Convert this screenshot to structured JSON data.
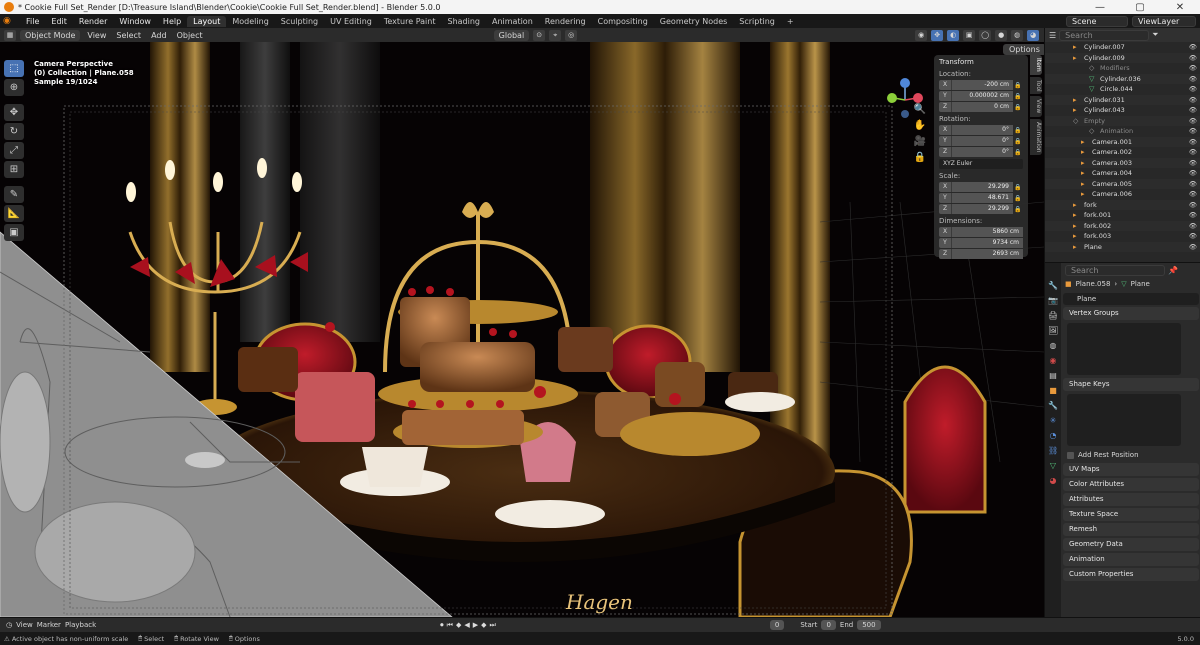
{
  "window": {
    "title": "* Cookie Full Set_Render [D:\\Treasure Island\\Blender\\Cookie\\Cookie Full Set_Render.blend] - Blender 5.0.0",
    "minimize": "—",
    "maximize": "▢",
    "close": "✕"
  },
  "menu": [
    "File",
    "Edit",
    "Render",
    "Window",
    "Help"
  ],
  "workspaces": [
    "Layout",
    "Modeling",
    "Sculpting",
    "UV Editing",
    "Texture Paint",
    "Shading",
    "Animation",
    "Rendering",
    "Compositing",
    "Geometry Nodes",
    "Scripting"
  ],
  "workspace_add": "+",
  "scene": "Scene",
  "view_layer": "ViewLayer",
  "viewport_header": {
    "mode": "Object Mode",
    "menus": [
      "View",
      "Select",
      "Add",
      "Object"
    ],
    "orientation": "Global",
    "options": "Options"
  },
  "overlay": {
    "line1": "Camera Perspective",
    "line2": "(0) Collection | Plane.058",
    "line3": "Sample 19/1024"
  },
  "signature": "Hagen",
  "npanel": {
    "header": "Transform",
    "location_label": "Location:",
    "location": [
      {
        "axis": "X",
        "value": "-200 cm"
      },
      {
        "axis": "Y",
        "value": "0.000002 cm"
      },
      {
        "axis": "Z",
        "value": "0 cm"
      }
    ],
    "rotation_label": "Rotation:",
    "rotation": [
      {
        "axis": "X",
        "value": "0°"
      },
      {
        "axis": "Y",
        "value": "0°"
      },
      {
        "axis": "Z",
        "value": "0°"
      }
    ],
    "rotation_mode": "XYZ Euler",
    "scale_label": "Scale:",
    "scale": [
      {
        "axis": "X",
        "value": "29.299"
      },
      {
        "axis": "Y",
        "value": "48.671"
      },
      {
        "axis": "Z",
        "value": "29.299"
      }
    ],
    "dimensions_label": "Dimensions:",
    "dimensions": [
      {
        "axis": "X",
        "value": "5860 cm"
      },
      {
        "axis": "Y",
        "value": "9734 cm"
      },
      {
        "axis": "Z",
        "value": "2693 cm"
      }
    ],
    "tabs": [
      "Item",
      "Tool",
      "View",
      "Animation"
    ]
  },
  "outliner": {
    "search_placeholder": "Search",
    "items": [
      {
        "name": "Cylinder.007",
        "kind": "o"
      },
      {
        "name": "Cylinder.009",
        "kind": "o"
      },
      {
        "name": "Modifiers",
        "kind": "c"
      },
      {
        "name": "Cylinder.036",
        "kind": "g"
      },
      {
        "name": "Circle.044",
        "kind": "g"
      },
      {
        "name": "Cylinder.031",
        "kind": "o"
      },
      {
        "name": "Cylinder.043",
        "kind": "o"
      },
      {
        "name": "Empty",
        "kind": "c"
      },
      {
        "name": "Animation",
        "kind": "c"
      },
      {
        "name": "Camera.001",
        "kind": "o"
      },
      {
        "name": "Camera.002",
        "kind": "o"
      },
      {
        "name": "Camera.003",
        "kind": "o"
      },
      {
        "name": "Camera.004",
        "kind": "o"
      },
      {
        "name": "Camera.005",
        "kind": "o"
      },
      {
        "name": "Camera.006",
        "kind": "o"
      },
      {
        "name": "fork",
        "kind": "o"
      },
      {
        "name": "fork.001",
        "kind": "o"
      },
      {
        "name": "fork.002",
        "kind": "o"
      },
      {
        "name": "fork.003",
        "kind": "o"
      },
      {
        "name": "Plane",
        "kind": "o"
      }
    ]
  },
  "properties": {
    "search_placeholder": "Search",
    "breadcrumb_object": "Plane.058",
    "breadcrumb_data": "Plane",
    "data_name": "Plane",
    "vertex_groups": "Vertex Groups",
    "shape_keys": "Shape Keys",
    "add_rest_position": "Add Rest Position",
    "panels": [
      "UV Maps",
      "Color Attributes",
      "Attributes",
      "Texture Space",
      "Remesh",
      "Geometry Data",
      "Animation",
      "Custom Properties"
    ]
  },
  "timeline": {
    "menus": [
      "View",
      "Marker",
      "Playback"
    ],
    "current_frame": "0",
    "start_label": "Start",
    "start": "0",
    "end_label": "End",
    "end": "500"
  },
  "status": {
    "message": "Active object has non-uniform scale",
    "select": "Select",
    "rotate": "Rotate View",
    "options": "Options",
    "version": "5.0.0"
  },
  "colors": {
    "accent": "#4772b3",
    "gold": "#c9972f",
    "velvet": "#8a0f1a",
    "object_icon": "#e99a3c",
    "mesh_icon": "#54c07a"
  }
}
